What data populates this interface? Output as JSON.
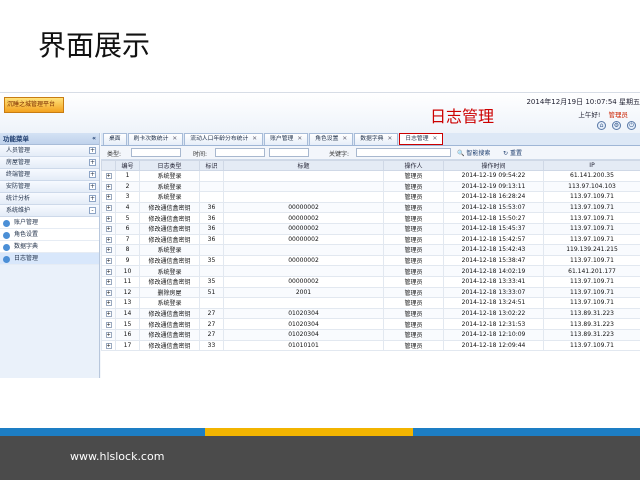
{
  "slide": {
    "title": "界面展示",
    "annotation": "日志管理",
    "footer_url": "www.hlslock.com"
  },
  "app": {
    "logo_text": "沉睡之城管理平台",
    "datetime": "2014年12月19日 10:07:54 星期五",
    "greeting": "上午好!",
    "user": "管理员"
  },
  "sidebar": {
    "header": "功能菜单",
    "menus": [
      {
        "label": "人员管理",
        "sign": "+"
      },
      {
        "label": "房屋管理",
        "sign": "+"
      },
      {
        "label": "终端管理",
        "sign": "+"
      },
      {
        "label": "安防管理",
        "sign": "+"
      },
      {
        "label": "统计分析",
        "sign": "+"
      },
      {
        "label": "系统维护",
        "sign": "-"
      }
    ],
    "subs": [
      {
        "label": "账户管理"
      },
      {
        "label": "角色设置"
      },
      {
        "label": "数据字典"
      },
      {
        "label": "日志管理"
      }
    ]
  },
  "tabs": [
    {
      "label": "桌面"
    },
    {
      "label": "刷卡次数统计"
    },
    {
      "label": "流动人口年龄分布统计"
    },
    {
      "label": "账户管理"
    },
    {
      "label": "角色设置"
    },
    {
      "label": "数据字典"
    },
    {
      "label": "日志管理"
    }
  ],
  "toolbar": {
    "type_label": "类型:",
    "time_label": "时间:",
    "keyword_label": "关键字:",
    "search_btn": "智能搜索",
    "reset_btn": "重置"
  },
  "table": {
    "headers": [
      "",
      "编号",
      "日志类型",
      "标识",
      "标题",
      "操作人",
      "操作时间",
      "IP"
    ],
    "rows": [
      [
        "1",
        "系统登录",
        "",
        "",
        "管理员",
        "2014-12-19 09:54:22",
        "61.141.200.35"
      ],
      [
        "2",
        "系统登录",
        "",
        "",
        "管理员",
        "2014-12-19 09:13:11",
        "113.97.104.103"
      ],
      [
        "3",
        "系统登录",
        "",
        "",
        "管理员",
        "2014-12-18 16:28:24",
        "113.97.109.71"
      ],
      [
        "4",
        "修改通信盒密钥",
        "36",
        "00000002",
        "管理员",
        "2014-12-18 15:53:07",
        "113.97.109.71"
      ],
      [
        "5",
        "修改通信盒密钥",
        "36",
        "00000002",
        "管理员",
        "2014-12-18 15:50:27",
        "113.97.109.71"
      ],
      [
        "6",
        "修改通信盒密钥",
        "36",
        "00000002",
        "管理员",
        "2014-12-18 15:45:37",
        "113.97.109.71"
      ],
      [
        "7",
        "修改通信盒密钥",
        "36",
        "00000002",
        "管理员",
        "2014-12-18 15:42:57",
        "113.97.109.71"
      ],
      [
        "8",
        "系统登录",
        "",
        "",
        "管理员",
        "2014-12-18 15:42:43",
        "119.139.241.215"
      ],
      [
        "9",
        "修改通信盒密钥",
        "35",
        "00000002",
        "管理员",
        "2014-12-18 15:38:47",
        "113.97.109.71"
      ],
      [
        "10",
        "系统登录",
        "",
        "",
        "管理员",
        "2014-12-18 14:02:19",
        "61.141.201.177"
      ],
      [
        "11",
        "修改通信盒密钥",
        "35",
        "00000002",
        "管理员",
        "2014-12-18 13:33:41",
        "113.97.109.71"
      ],
      [
        "12",
        "删除房屋",
        "51",
        "2001",
        "管理员",
        "2014-12-18 13:33:07",
        "113.97.109.71"
      ],
      [
        "13",
        "系统登录",
        "",
        "",
        "管理员",
        "2014-12-18 13:24:51",
        "113.97.109.71"
      ],
      [
        "14",
        "修改通信盒密钥",
        "27",
        "01020304",
        "管理员",
        "2014-12-18 13:02:22",
        "113.89.31.223"
      ],
      [
        "15",
        "修改通信盒密钥",
        "27",
        "01020304",
        "管理员",
        "2014-12-18 12:31:53",
        "113.89.31.223"
      ],
      [
        "16",
        "修改通信盒密钥",
        "27",
        "01020304",
        "管理员",
        "2014-12-18 12:10:09",
        "113.89.31.223"
      ],
      [
        "17",
        "修改通信盒密钥",
        "33",
        "01010101",
        "管理员",
        "2014-12-18 12:09:44",
        "113.97.109.71"
      ]
    ]
  }
}
